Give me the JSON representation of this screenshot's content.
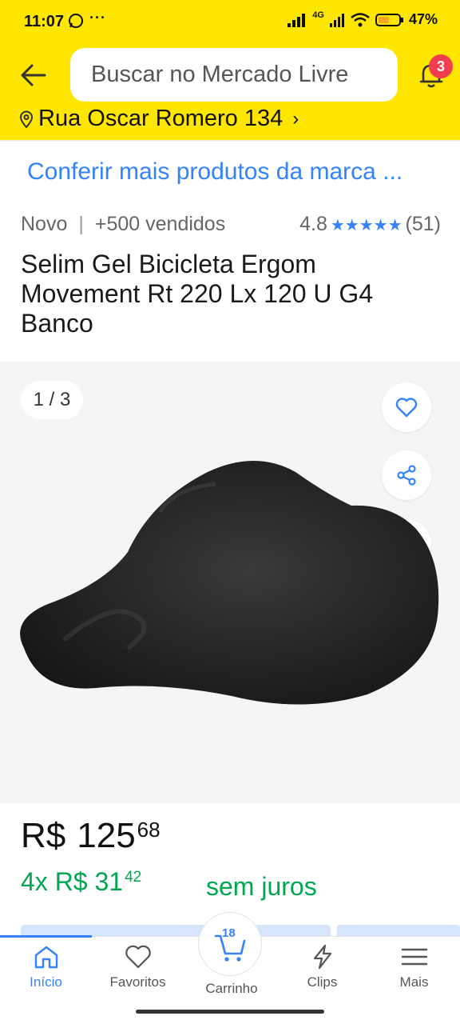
{
  "status_bar": {
    "time": "11:07",
    "dots": "···",
    "network": "4G",
    "battery": "47%"
  },
  "header": {
    "search_placeholder": "Buscar no Mercado Livre",
    "notification_count": "3",
    "address": "Rua Oscar Romero 134"
  },
  "product": {
    "brand_link": "Conferir mais produtos da marca ...",
    "condition": "Novo",
    "sold": "+500 vendidos",
    "rating": "4.8",
    "stars": "★★★★★",
    "reviews": "(51)",
    "title": "Selim Gel Bicicleta Ergom Movement Rt 220 Lx 120 U G4 Banco",
    "gallery_counter": "1 / 3"
  },
  "price": {
    "currency": "R$",
    "integer": "125",
    "cents": "68",
    "installments_prefix": "4x R$ 31",
    "installments_cents": "42",
    "installments_suffix": "sem juros"
  },
  "nav": {
    "items": [
      {
        "label": "Início",
        "icon": "home-icon",
        "active": true
      },
      {
        "label": "Favoritos",
        "icon": "heart-icon"
      },
      {
        "label": "Carrinho",
        "icon": "cart-icon",
        "count": "18"
      },
      {
        "label": "Clips",
        "icon": "bolt-icon"
      },
      {
        "label": "Mais",
        "icon": "menu-icon"
      }
    ]
  },
  "colors": {
    "header_yellow": "#ffe600",
    "link_blue": "#3483fa",
    "price_green": "#00a650",
    "badge_red": "#f23d4f"
  }
}
